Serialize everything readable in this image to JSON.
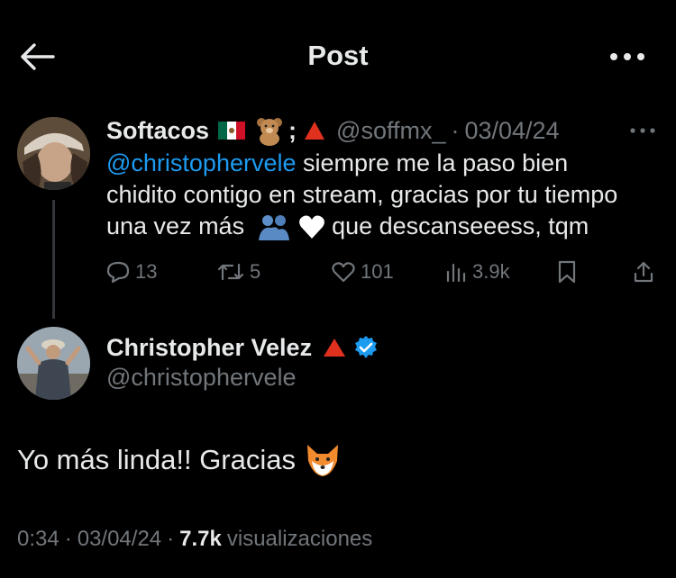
{
  "header": {
    "title": "Post",
    "back_icon": "arrow-left-icon",
    "more_icon": "more-horizontal-icon"
  },
  "reply_to": {
    "name": "Softacos",
    "name_emojis": [
      "mexico-flag",
      "teddy-bear",
      ";",
      "red-triangle"
    ],
    "handle": "@soffmx_",
    "separator": "·",
    "date": "03/04/24",
    "text": {
      "mention": "@christophervele",
      "body_line1": " siempre me la paso bien",
      "body_line2": "chidito contigo en stream, gracias por tu tiempo",
      "body_line3_before": "una vez más ",
      "body_line3_after": " que descanseeess, tqm",
      "emojis": [
        "people-hugging",
        "white-heart"
      ]
    },
    "actions": {
      "replies": "13",
      "reposts": "5",
      "likes": "101",
      "views": "3.9k"
    }
  },
  "post": {
    "name": "Christopher Velez",
    "handle": "@christophervele",
    "verified": true,
    "text": "Yo más linda!! Gracias",
    "text_emoji": "fox-face",
    "time": "0:34",
    "separator": "·",
    "date": "03/04/24",
    "views_count": "7.7k",
    "views_label": "visualizaciones"
  },
  "colors": {
    "background": "#000000",
    "primary_text": "#e7e9ea",
    "secondary_text": "#71767b",
    "accent": "#1d9bf0"
  }
}
